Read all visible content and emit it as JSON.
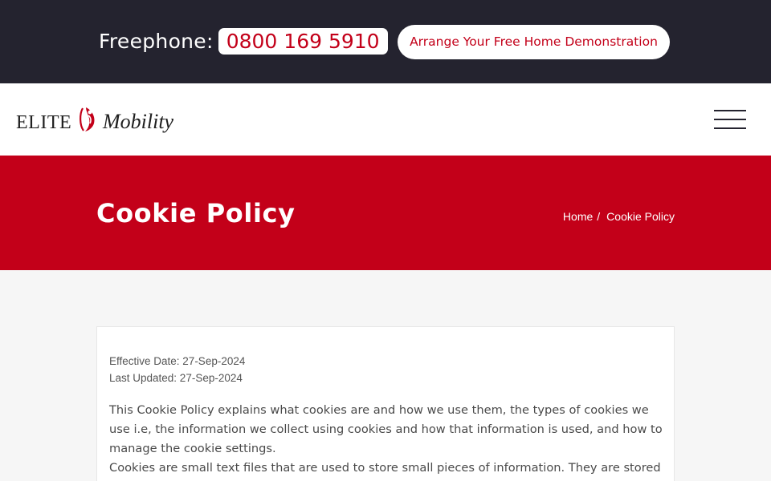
{
  "topbar": {
    "freephone_label": "Freephone:",
    "phone_number": "0800 169 5910",
    "demo_button": "Arrange Your Free Home Demonstration"
  },
  "header": {
    "logo_word_1": "ELITE",
    "logo_word_2": "Mobility",
    "menu_icon": "hamburger-menu-icon"
  },
  "banner": {
    "title": "Cookie Policy",
    "breadcrumb": [
      {
        "label": "Home",
        "separator": "/"
      },
      {
        "label": "Cookie Policy"
      }
    ]
  },
  "content": {
    "effective_date": "Effective Date: 27-Sep-2024",
    "last_updated": "Last Updated: 27-Sep-2024",
    "paragraph_1": "This Cookie Policy explains what cookies are and how we use them, the types of cookies we use i.e, the information we collect using cookies and how that information is used, and how to manage the cookie settings.",
    "paragraph_2": "Cookies are small text files that are used to store small pieces of information. They are stored on"
  },
  "colors": {
    "topbar_bg": "#24232f",
    "brand_red": "#c30019",
    "page_bg": "#f6f6f6"
  }
}
